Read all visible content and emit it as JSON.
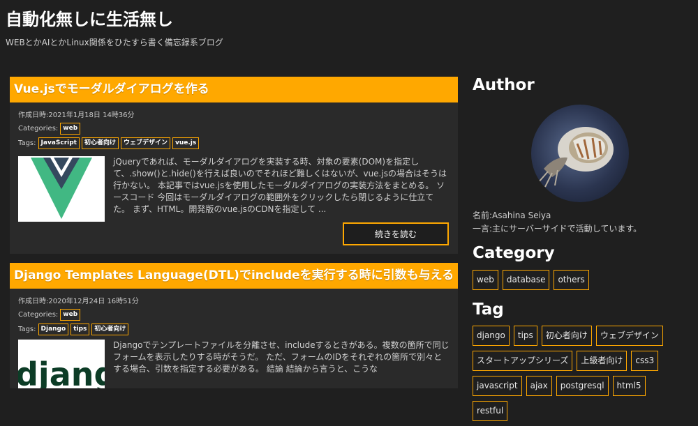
{
  "site": {
    "title": "自動化無しに生活無し",
    "description": "WEBとかAIとかLinux関係をひたすら書く備忘録系ブログ"
  },
  "posts": [
    {
      "title": "Vue.jsでモーダルダイアログを作る",
      "date_label": "作成日時:2021年1月18日 14時36分",
      "categories_label": "Categories:",
      "categories": [
        "web"
      ],
      "tags_label": "Tags:",
      "tags": [
        "JavaScript",
        "初心者向け",
        "ウェブデザイン",
        "vue.js"
      ],
      "excerpt": "jQueryであれば、モーダルダイアログを実装する時、対象の要素(DOM)を指定して、.show()と.hide()を行えば良いのでそれほど難しくはないが、vue.jsの場合はそうは行かない。 本記事ではvue.jsを使用したモーダルダイアログの実装方法をまとめる。 ソースコード 今回はモーダルダイアログの範囲外をクリックしたら閉じるように仕立てた。 まず、HTML。開発版のvue.jsのCDNを指定して ...",
      "read_more": "続きを読む",
      "thumbnail_icon": "vue-logo-icon"
    },
    {
      "title": "Django Templates Language(DTL)でincludeを実行する時に引数も与える",
      "date_label": "作成日時:2020年12月24日 16時51分",
      "categories_label": "Categories:",
      "categories": [
        "web"
      ],
      "tags_label": "Tags:",
      "tags": [
        "Django",
        "tips",
        "初心者向け"
      ],
      "excerpt": "Djangoでテンプレートファイルを分離させ、includeするときがある。複数の箇所で同じフォームを表示したりする時がそうだ。 ただ、フォームのIDをそれぞれの箇所で別々とする場合、引数を指定する必要がある。 結論 結論から言うと、こうな",
      "thumbnail_text": "django",
      "thumbnail_icon": "django-logo-icon"
    }
  ],
  "sidebar": {
    "author_heading": "Author",
    "author_name": "名前:Asahina Seiya",
    "author_bio": "一言:主にサーバーサイドで活動しています。",
    "category_heading": "Category",
    "categories": [
      "web",
      "database",
      "others"
    ],
    "tag_heading": "Tag",
    "tags": [
      "django",
      "tips",
      "初心者向け",
      "ウェブデザイン",
      "スタートアップシリーズ",
      "上級者向け",
      "css3",
      "javascript",
      "ajax",
      "postgresql",
      "html5",
      "restful"
    ]
  },
  "colors": {
    "accent": "#ffa800",
    "background": "#1f1f1f",
    "card": "#2a2a2a"
  }
}
